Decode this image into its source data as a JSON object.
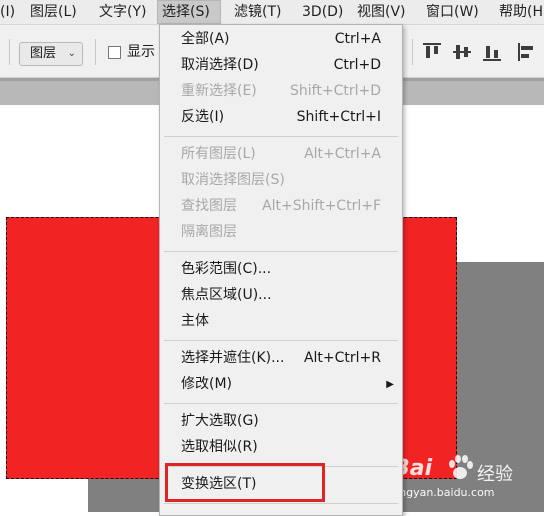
{
  "menubar": {
    "items": [
      {
        "label": "(I)"
      },
      {
        "label": "图层(L)"
      },
      {
        "label": "文字(Y)"
      },
      {
        "label": "选择(S)"
      },
      {
        "label": "滤镜(T)"
      },
      {
        "label": "3D(D)"
      },
      {
        "label": "视图(V)"
      },
      {
        "label": "窗口(W)"
      },
      {
        "label": "帮助(H"
      }
    ]
  },
  "options": {
    "layer_select": "图层",
    "show_label": "显示"
  },
  "select_menu": {
    "items": [
      {
        "label": "全部(A)",
        "shortcut": "Ctrl+A",
        "enabled": true
      },
      {
        "label": "取消选择(D)",
        "shortcut": "Ctrl+D",
        "enabled": true
      },
      {
        "label": "重新选择(E)",
        "shortcut": "Shift+Ctrl+D",
        "enabled": false
      },
      {
        "label": "反选(I)",
        "shortcut": "Shift+Ctrl+I",
        "enabled": true
      },
      {
        "label": "所有图层(L)",
        "shortcut": "Alt+Ctrl+A",
        "enabled": false
      },
      {
        "label": "取消选择图层(S)",
        "shortcut": "",
        "enabled": false
      },
      {
        "label": "查找图层",
        "shortcut": "Alt+Shift+Ctrl+F",
        "enabled": false
      },
      {
        "label": "隔离图层",
        "shortcut": "",
        "enabled": false
      },
      {
        "label": "色彩范围(C)...",
        "shortcut": "",
        "enabled": true
      },
      {
        "label": "焦点区域(U)...",
        "shortcut": "",
        "enabled": true
      },
      {
        "label": "主体",
        "shortcut": "",
        "enabled": true
      },
      {
        "label": "选择并遮住(K)...",
        "shortcut": "Alt+Ctrl+R",
        "enabled": true
      },
      {
        "label": "修改(M)",
        "shortcut": "",
        "enabled": true
      },
      {
        "label": "扩大选取(G)",
        "shortcut": "",
        "enabled": true
      },
      {
        "label": "选取相似(R)",
        "shortcut": "",
        "enabled": true
      },
      {
        "label": "变换选区(T)",
        "shortcut": "",
        "enabled": true
      }
    ]
  },
  "watermark": {
    "brand": "Bai",
    "suffix": "经验",
    "url": "jingyan.baidu.com"
  },
  "colors": {
    "red_layer": "#f22323",
    "gray_layer": "#808080",
    "highlight": "#e02424"
  }
}
